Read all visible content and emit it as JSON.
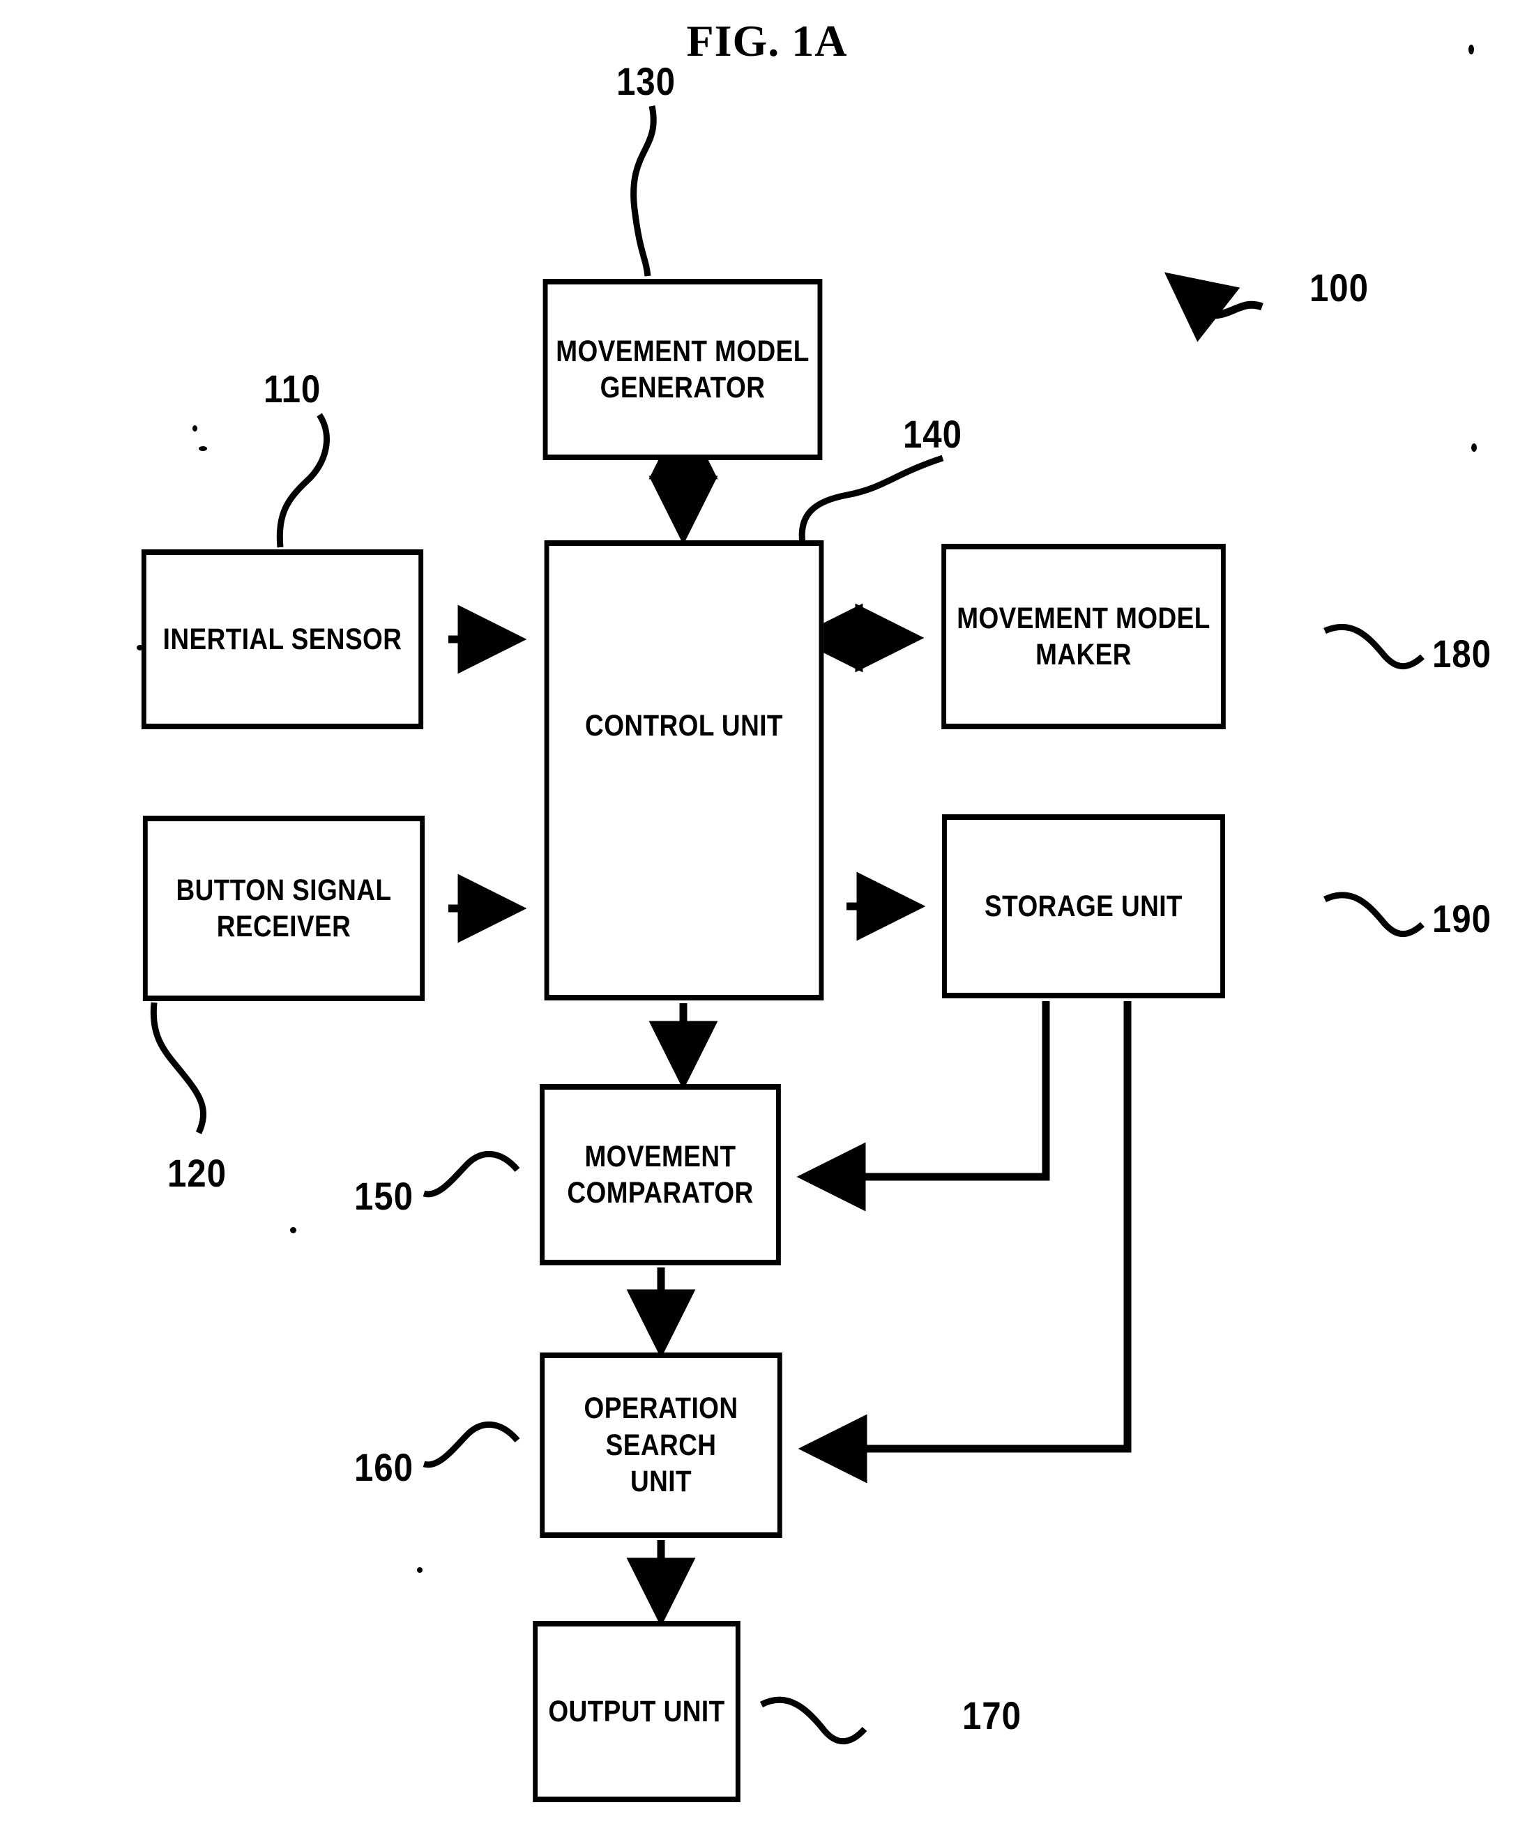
{
  "figure": {
    "title": "FIG. 1A",
    "type": "block-diagram",
    "system_reference": "100"
  },
  "nodes": [
    {
      "id": "movement-model-generator",
      "label": "MOVEMENT MODEL\nGENERATOR",
      "ref": "130"
    },
    {
      "id": "inertial-sensor",
      "label": "INERTIAL SENSOR",
      "ref": "110"
    },
    {
      "id": "control-unit",
      "label": "CONTROL UNIT",
      "ref": "140"
    },
    {
      "id": "movement-model-maker",
      "label": "MOVEMENT MODEL\nMAKER",
      "ref": "180"
    },
    {
      "id": "button-signal-receiver",
      "label": "BUTTON SIGNAL\nRECEIVER",
      "ref": "120"
    },
    {
      "id": "storage-unit",
      "label": "STORAGE UNIT",
      "ref": "190"
    },
    {
      "id": "movement-comparator",
      "label": "MOVEMENT\nCOMPARATOR",
      "ref": "150"
    },
    {
      "id": "operation-search-unit",
      "label": "OPERATION SEARCH\nUNIT",
      "ref": "160"
    },
    {
      "id": "output-unit",
      "label": "OUTPUT UNIT",
      "ref": "170"
    }
  ],
  "reference_numerals": {
    "n100": "100",
    "n110": "110",
    "n120": "120",
    "n130": "130",
    "n140": "140",
    "n150": "150",
    "n160": "160",
    "n170": "170",
    "n180": "180",
    "n190": "190"
  },
  "connections": [
    {
      "from": "movement-model-generator",
      "to": "control-unit",
      "arrow": "double"
    },
    {
      "from": "inertial-sensor",
      "to": "control-unit",
      "arrow": "single"
    },
    {
      "from": "button-signal-receiver",
      "to": "control-unit",
      "arrow": "single"
    },
    {
      "from": "control-unit",
      "to": "movement-model-maker",
      "arrow": "double"
    },
    {
      "from": "control-unit",
      "to": "storage-unit",
      "arrow": "single"
    },
    {
      "from": "control-unit",
      "to": "movement-comparator",
      "arrow": "single"
    },
    {
      "from": "movement-comparator",
      "to": "operation-search-unit",
      "arrow": "single"
    },
    {
      "from": "operation-search-unit",
      "to": "output-unit",
      "arrow": "single"
    },
    {
      "from": "storage-unit",
      "to": "movement-comparator",
      "arrow": "single"
    },
    {
      "from": "storage-unit",
      "to": "operation-search-unit",
      "arrow": "single"
    }
  ],
  "style": {
    "stroke_color": "#000000",
    "background_color": "#ffffff"
  }
}
